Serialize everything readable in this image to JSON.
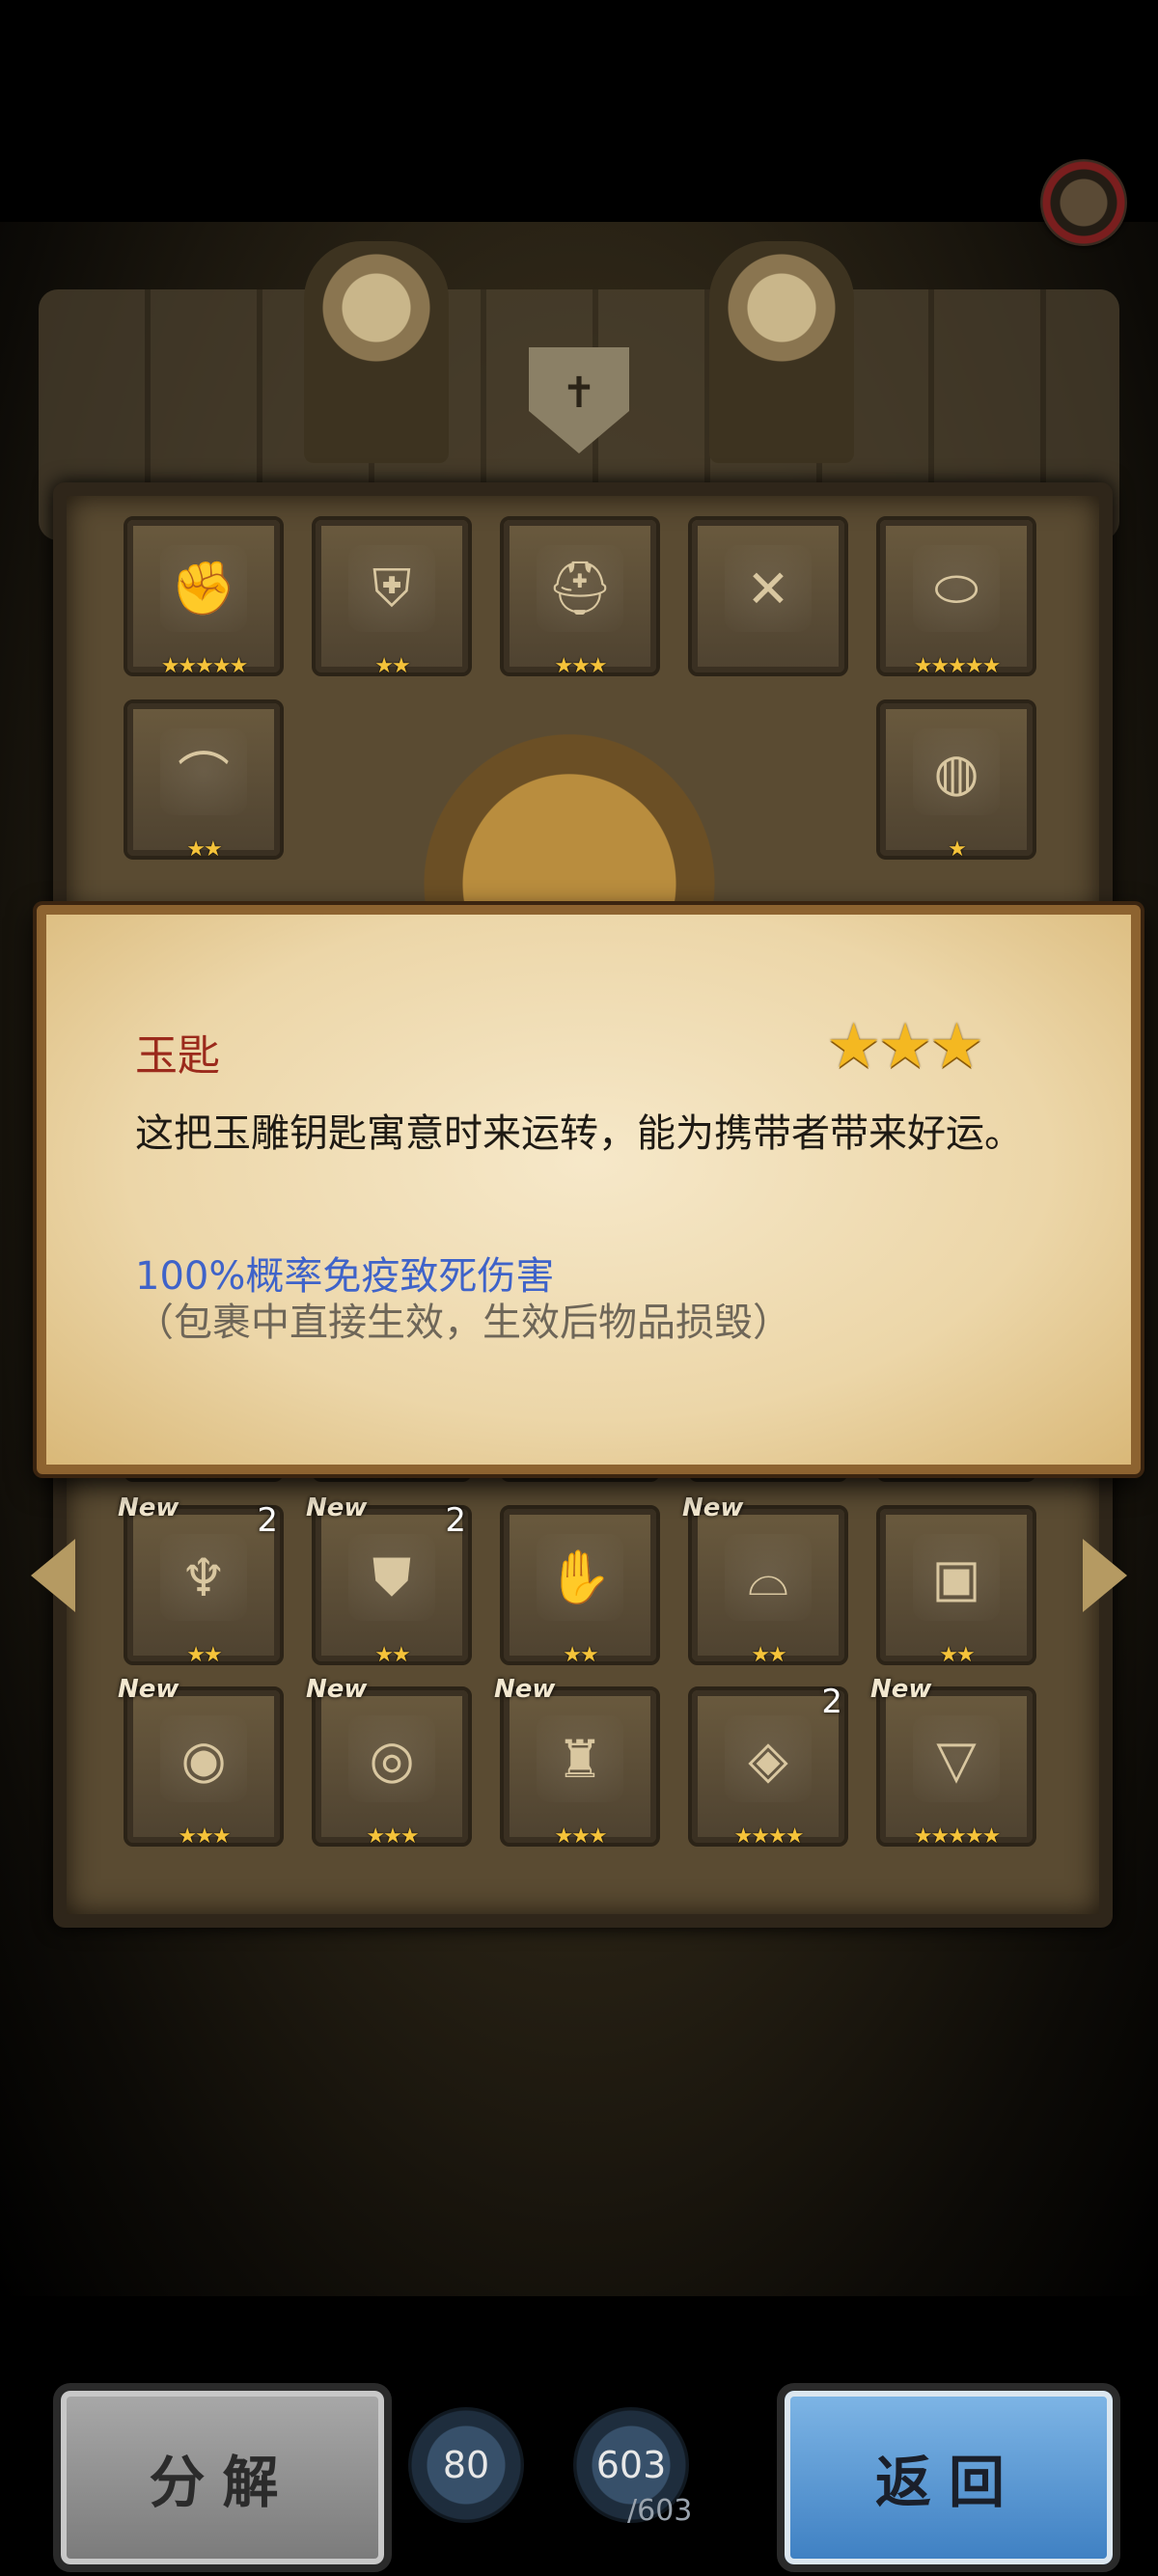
{
  "inventory": {
    "row1": [
      {
        "icon": "gauntlet-icon",
        "glyph": "✊",
        "stars": "★★★★★",
        "new": "",
        "count": ""
      },
      {
        "icon": "armor-icon",
        "glyph": "⛨",
        "stars": "★★",
        "new": "",
        "count": ""
      },
      {
        "icon": "helmet-icon",
        "glyph": "⛑",
        "stars": "★★★",
        "new": "",
        "count": ""
      },
      {
        "icon": "empty-crossbow-icon",
        "glyph": "✕",
        "stars": "",
        "new": "",
        "count": ""
      },
      {
        "icon": "lock-pendant-icon",
        "glyph": "⬭",
        "stars": "★★★★★",
        "new": "",
        "count": ""
      }
    ],
    "row2": [
      {
        "icon": "shoulder-icon",
        "glyph": "⌒",
        "stars": "★★",
        "new": "",
        "count": ""
      },
      {
        "icon": "ring-icon",
        "glyph": "◍",
        "stars": "★",
        "new": "",
        "count": ""
      }
    ],
    "row3_partial": [
      {
        "stars": "★★★"
      },
      {
        "stars": "★★★"
      },
      {
        "stars": "★★★★"
      },
      {
        "stars": "★"
      },
      {
        "stars": "★"
      }
    ],
    "row4": [
      {
        "icon": "winged-helmet-icon",
        "glyph": "♆",
        "stars": "★★",
        "new": "New",
        "count": "2"
      },
      {
        "icon": "chest-armor-icon",
        "glyph": "⛊",
        "stars": "★★",
        "new": "New",
        "count": "2"
      },
      {
        "icon": "gold-gauntlet-icon",
        "glyph": "✋",
        "stars": "★★",
        "new": "",
        "count": ""
      },
      {
        "icon": "pauldron-icon",
        "glyph": "⌓",
        "stars": "★★",
        "new": "New",
        "count": ""
      },
      {
        "icon": "chest-icon",
        "glyph": "▣",
        "stars": "★★",
        "new": "",
        "count": ""
      }
    ],
    "row5": [
      {
        "icon": "bracer-icon",
        "glyph": "◉",
        "stars": "★★★",
        "new": "New",
        "count": ""
      },
      {
        "icon": "gem-ring-icon",
        "glyph": "◎",
        "stars": "★★★",
        "new": "New",
        "count": ""
      },
      {
        "icon": "fur-cloak-icon",
        "glyph": "♜",
        "stars": "★★★",
        "new": "New",
        "count": ""
      },
      {
        "icon": "amulet-icon",
        "glyph": "◈",
        "stars": "★★★★",
        "new": "",
        "count": "2"
      },
      {
        "icon": "necklace-icon",
        "glyph": "▽",
        "stars": "★★★★★",
        "new": "New",
        "count": ""
      }
    ]
  },
  "tooltip": {
    "title": "玉匙",
    "stars": "★★★",
    "description": "这把玉雕钥匙寓意时来运转，能为携带者带来好运。",
    "effect": "100%概率免疫致死伤害",
    "note": "（包裹中直接生效，生效后物品损毁）"
  },
  "footer": {
    "decompose_label": "分解",
    "back_label": "返回",
    "resource1": "80",
    "resource2": "603",
    "resource2_max": "/603"
  },
  "colors": {
    "tooltip_title": "#9b2a1c",
    "effect_text": "#3f63c9",
    "star": "#f4b821"
  }
}
